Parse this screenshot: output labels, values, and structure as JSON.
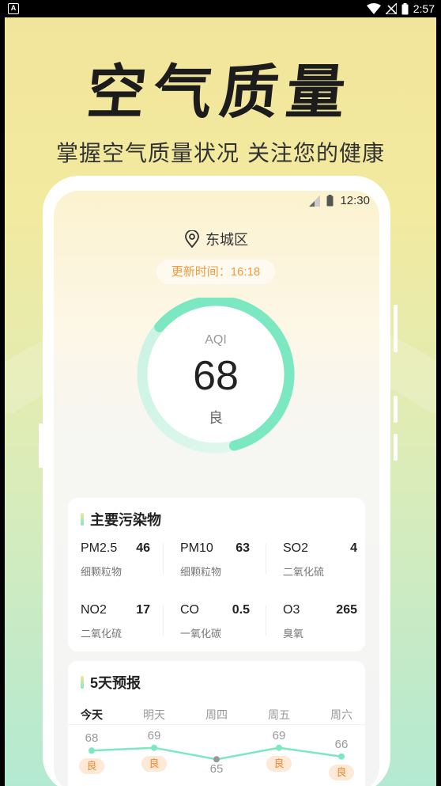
{
  "status_bar": {
    "time": "2:57",
    "left_icon": "A"
  },
  "hero": {
    "title": "空气质量",
    "subtitle": "掌握空气质量状况 关注您的健康"
  },
  "screen": {
    "time": "12:30",
    "location": "东城区",
    "update_label": "更新时间：16:18",
    "aqi": {
      "label": "AQI",
      "value": "68",
      "level": "良",
      "progress": 0.68
    },
    "pollutants": {
      "title": "主要污染物",
      "items": [
        {
          "name": "PM2.5",
          "value": "46",
          "desc": "细颗粒物"
        },
        {
          "name": "PM10",
          "value": "63",
          "desc": "细颗粒物"
        },
        {
          "name": "SO2",
          "value": "4",
          "desc": "二氧化硫"
        },
        {
          "name": "NO2",
          "value": "17",
          "desc": "二氧化硫"
        },
        {
          "name": "CO",
          "value": "0.5",
          "desc": "一氧化碳"
        },
        {
          "name": "O3",
          "value": "265",
          "desc": "臭氧"
        }
      ]
    },
    "forecast": {
      "title": "5天预报",
      "days": [
        {
          "day": "今天",
          "aqi": "68",
          "level": "良"
        },
        {
          "day": "明天",
          "aqi": "69",
          "level": "良"
        },
        {
          "day": "周四",
          "aqi": "65",
          "level": ""
        },
        {
          "day": "周五",
          "aqi": "69",
          "level": "良"
        },
        {
          "day": "周六",
          "aqi": "66",
          "level": "良"
        }
      ]
    }
  },
  "colors": {
    "accent": "#7ce8c2",
    "orange": "#f09a3c"
  }
}
